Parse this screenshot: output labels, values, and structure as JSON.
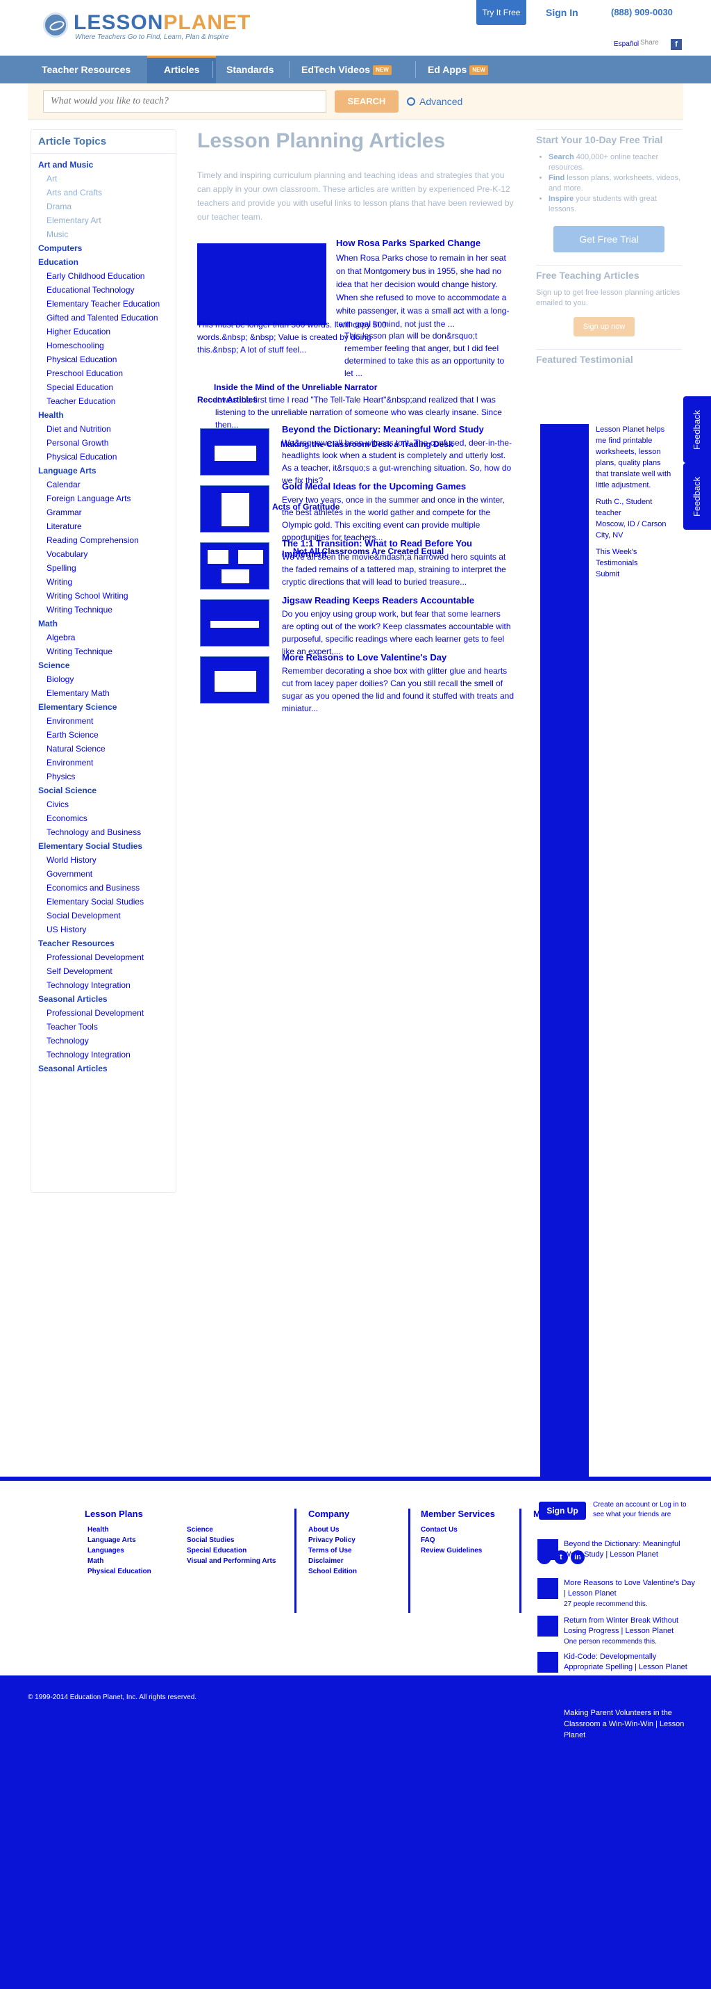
{
  "header": {
    "logo_text_main": "LESSON",
    "logo_text_accent": "PLANET",
    "logo_tagline": "Where Teachers Go to Find, Learn, Plan & Inspire",
    "try_label": "Try It Free",
    "signin_label": "Sign In",
    "phone": "(888) 909-0030",
    "language_link": "Español",
    "share_label": "Share",
    "facebook_glyph": "f"
  },
  "nav": {
    "items": [
      {
        "label": "Teacher Resources"
      },
      {
        "label": "Articles"
      },
      {
        "label": "Standards"
      },
      {
        "label": "EdTech Videos",
        "badge": "NEW"
      },
      {
        "label": "Ed Apps",
        "badge": "NEW"
      }
    ]
  },
  "search": {
    "placeholder": "What would you like to teach?",
    "button": "SEARCH",
    "advanced": "Advanced"
  },
  "sidebar": {
    "title": "Article Topics",
    "items": [
      {
        "label": "Art and Music",
        "level": "top"
      },
      {
        "label": "Art",
        "level": "sub"
      },
      {
        "label": "Arts and Crafts",
        "level": "sub"
      },
      {
        "label": "Drama",
        "level": "sub"
      },
      {
        "label": "Elementary Art",
        "level": "sub"
      },
      {
        "label": "Music",
        "level": "sub"
      },
      {
        "label": "Computers",
        "level": "top"
      },
      {
        "label": "Education",
        "level": "top"
      },
      {
        "label": "Early Childhood Education",
        "level": "sub"
      },
      {
        "label": "Educational Technology",
        "level": "sub"
      },
      {
        "label": "Elementary Teacher Education",
        "level": "sub"
      },
      {
        "label": "Gifted and Talented Education",
        "level": "sub"
      },
      {
        "label": "Higher Education",
        "level": "sub"
      },
      {
        "label": "Homeschooling",
        "level": "sub"
      },
      {
        "label": "Physical Education",
        "level": "sub"
      },
      {
        "label": "Preschool Education",
        "level": "sub"
      },
      {
        "label": "Special Education",
        "level": "sub"
      },
      {
        "label": "Teacher Education",
        "level": "sub"
      },
      {
        "label": "Health",
        "level": "top"
      },
      {
        "label": "Diet and Nutrition",
        "level": "sub"
      },
      {
        "label": "Personal Growth",
        "level": "sub"
      },
      {
        "label": "Physical Education",
        "level": "sub"
      },
      {
        "label": "Language Arts",
        "level": "top"
      },
      {
        "label": "Calendar",
        "level": "sub"
      },
      {
        "label": "Foreign Language Arts",
        "level": "sub"
      },
      {
        "label": "Grammar",
        "level": "sub"
      },
      {
        "label": "Literature",
        "level": "sub"
      },
      {
        "label": "Reading Comprehension",
        "level": "sub"
      },
      {
        "label": "Vocabulary",
        "level": "sub"
      },
      {
        "label": "Spelling",
        "level": "sub"
      },
      {
        "label": "Writing",
        "level": "sub"
      },
      {
        "label": "Writing School Writing",
        "level": "sub"
      },
      {
        "label": "Writing Technique",
        "level": "sub"
      },
      {
        "label": "Math",
        "level": "top"
      },
      {
        "label": "Algebra",
        "level": "sub"
      },
      {
        "label": "Writing Technique",
        "level": "sub"
      },
      {
        "label": "Science",
        "level": "top"
      },
      {
        "label": "Biology",
        "level": "sub"
      },
      {
        "label": "Elementary Math",
        "level": "sub"
      },
      {
        "label": "Elementary Science",
        "level": "top"
      },
      {
        "label": "Environment",
        "level": "sub"
      },
      {
        "label": "Earth Science",
        "level": "sub"
      },
      {
        "label": "Natural Science",
        "level": "sub"
      },
      {
        "label": "Environment",
        "level": "sub"
      },
      {
        "label": "Physics",
        "level": "sub"
      },
      {
        "label": "Social Science",
        "level": "top"
      },
      {
        "label": "Civics",
        "level": "sub"
      },
      {
        "label": "Economics",
        "level": "sub"
      },
      {
        "label": "Technology and Business",
        "level": "sub"
      },
      {
        "label": "Elementary Social Studies",
        "level": "top"
      },
      {
        "label": "World History",
        "level": "sub"
      },
      {
        "label": "Government",
        "level": "sub"
      },
      {
        "label": "Economics and Business",
        "level": "sub"
      },
      {
        "label": "Elementary Social Studies",
        "level": "sub"
      },
      {
        "label": "Social Development",
        "level": "sub"
      },
      {
        "label": "US History",
        "level": "sub"
      },
      {
        "label": "Teacher Resources",
        "level": "top"
      },
      {
        "label": "Professional Development",
        "level": "sub"
      },
      {
        "label": "Self Development",
        "level": "sub"
      },
      {
        "label": "Technology Integration",
        "level": "sub"
      },
      {
        "label": "Seasonal Articles",
        "level": "top"
      },
      {
        "label": "Professional Development",
        "level": "sub"
      },
      {
        "label": "Teacher Tools",
        "level": "sub"
      },
      {
        "label": "Technology",
        "level": "sub"
      },
      {
        "label": "Technology Integration",
        "level": "sub"
      },
      {
        "label": "Seasonal Articles",
        "level": "top"
      }
    ]
  },
  "main": {
    "title": "Lesson Planning Articles",
    "intro": "Timely and inspiring curriculum planning and teaching ideas and strategies that you can apply in your own classroom. These articles are written by experienced Pre-K-12 teachers and provide you with useful links to lesson plans that have been reviewed by our teacher team.",
    "featured": {
      "title": "How Rosa Parks Sparked Change",
      "body": "When Rosa Parks chose to remain in her seat on that Montgomery bus in 1955, she had no idea that her decision would change history. When she refused to move to accommodate a white passenger, it was a small act with a long-term goal in mind, not just the ...",
      "overlay_1": "This must be longer than 500 words. I will copy 500 words.&nbsp; &nbsp; Value is created by doing this.&nbsp; A lot of stuff feel...",
      "overlay_2": "This lesson plan will be don&rsquo;t remember feeling that anger, but I did feel determined to take this as an opportunity to let ..."
    },
    "recent_label": "Recent Articles",
    "unreliable": {
      "title": "Inside the Mind of the Unreliable Narrator",
      "body": "It was the first time I read \"The Tell-Tale Heart\"&nbsp;and realized that I was listening to the unreliable narration of someone who was clearly insane. Since then..."
    },
    "articles": [
      {
        "title": "Beyond the Dictionary: Meaningful Word Study",
        "body": "We&rsquo;ve all been witness to it. The confused, deer-in-the-headlights look when a student is completely and utterly lost. As a teacher, it&rsquo;s a gut-wrenching situation. So, how do we fix this?"
      },
      {
        "title": "Gold Medal Ideas for the Upcoming Games",
        "body": "Every two years, once in the summer and once in the winter, the best athletes in the world gather and compete for the Olympic gold. This exciting event can provide multiple opportunities for teachers..."
      },
      {
        "title": "The 1:1 Transition: What to Read Before You Implement",
        "body": "We've all seen the movie&mdash;a harrowed hero squints at the faded remains of a tattered map, straining to interpret the cryptic directions that will lead to buried treasure..."
      },
      {
        "title": "Jigsaw Reading Keeps Readers Accountable",
        "body": "Do you enjoy using group work, but fear that some learners are opting out of the work? Keep classmates accountable with purposeful, specific readings where each learner gets to feel like an expert,..."
      },
      {
        "title": "More Reasons to Love Valentine's Day",
        "body": "Remember decorating a shoe box with glitter glue and hearts cut from lacey paper doilies? Can you still recall the smell of sugar as you opened the lid and found it stuffed with treats and miniatur..."
      }
    ],
    "overlay_titles": [
      "Making the Classroom Desk a Trading Desk",
      "Acts of Gratitude",
      "Not All Classrooms Are Created Equal"
    ]
  },
  "right": {
    "trial_title": "Start Your 10-Day Free Trial",
    "trial_items": [
      {
        "bold": "Search",
        "rest": " 400,000+ online teacher resources."
      },
      {
        "bold": "Find",
        "rest": " lesson plans, worksheets, videos, and more."
      },
      {
        "bold": "Inspire",
        "rest": " your students with great lessons."
      }
    ],
    "trial_button": "Get Free Trial",
    "free_articles_title": "Free Teaching Articles",
    "free_articles_text": "Sign up to get free lesson planning articles emailed to you.",
    "free_articles_button": "Sign up now",
    "testimonial_title": "Featured Testimonial",
    "testimonial_text": "Lesson Planet helps me find printable worksheets, lesson plans, quality plans that translate well with little adjustment.",
    "testimonial_name": "Ruth C., Student teacher",
    "testimonial_place": "Moscow, ID / Carson City, NV",
    "weeks_label": "This Week's Testimonials",
    "submit_label": "Submit",
    "feedback_label": "Feedback"
  },
  "footer": {
    "lesson_plans_title": "Lesson Plans",
    "lesson_plans_col1": [
      "Health",
      "Language Arts",
      "Languages",
      "Math",
      "Physical Education"
    ],
    "lesson_plans_col2": [
      "Science",
      "Social Studies",
      "Special Education",
      "Visual and Performing Arts"
    ],
    "company_title": "Company",
    "company_items": [
      "About Us",
      "Privacy Policy",
      "Terms of Use",
      "Disclaimer",
      "School Edition"
    ],
    "member_title": "Member Services",
    "member_items": [
      "Contact Us",
      "FAQ",
      "Review Guidelines"
    ],
    "more_title": "More",
    "signup_button": "Sign Up",
    "signup_text": "Create an account or Log in to see what your friends are",
    "related": [
      {
        "title": "Beyond the Dictionary: Meaningful Word Study | Lesson Planet",
        "count": ""
      },
      {
        "title": "More Reasons to Love Valentine's Day | Lesson Planet",
        "count": "27 people recommend this."
      },
      {
        "title": "Return from Winter Break Without Losing Progress | Lesson Planet",
        "count": "One person recommends this."
      },
      {
        "title": "Kid-Code: Developmentally Appropriate Spelling | Lesson Planet",
        "count": ""
      }
    ],
    "copyright": "© 1999-2014 Education Planet, Inc. All rights reserved.",
    "bottom_link": "Making Parent Volunteers in the Classroom a Win-Win-Win | Lesson Planet"
  }
}
